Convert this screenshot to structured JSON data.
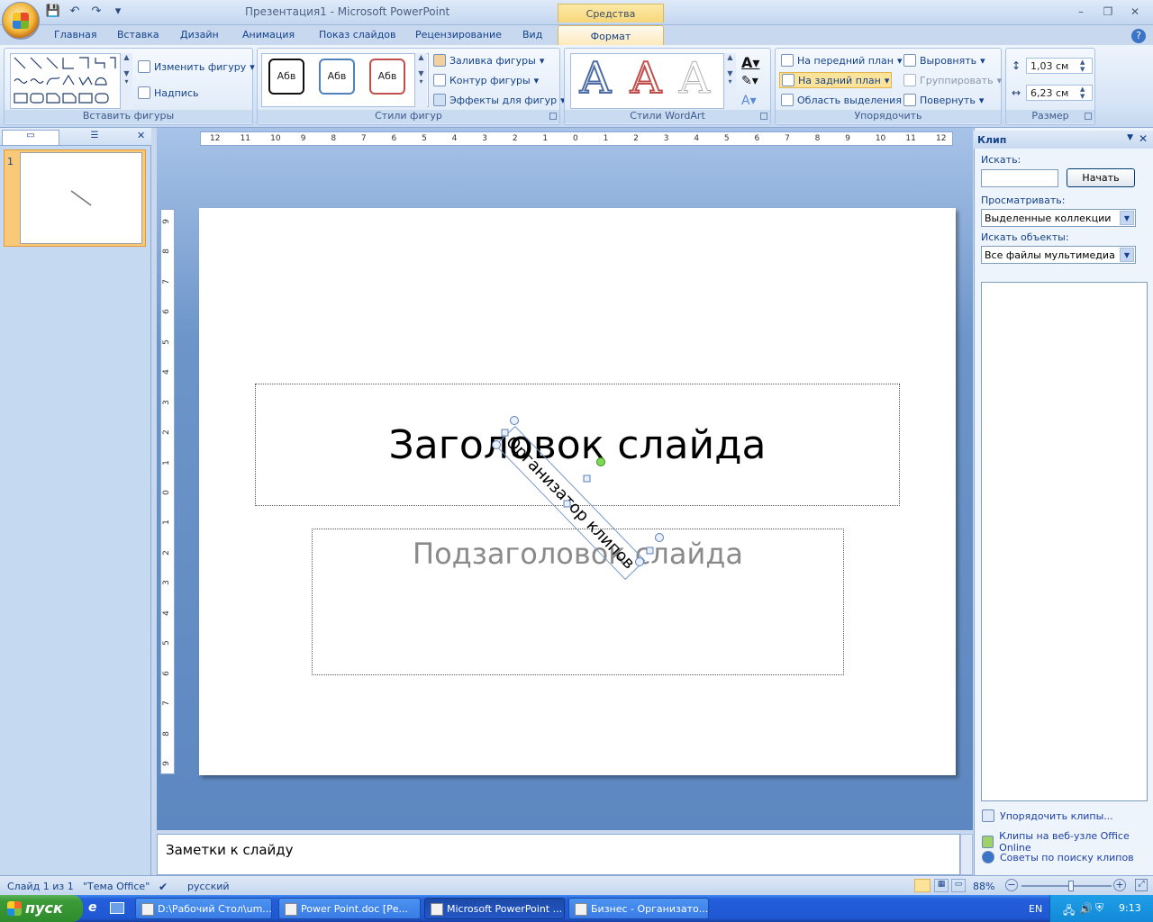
{
  "window": {
    "title": "Презентация1 - Microsoft PowerPoint",
    "context_tab_header": "Средства рисования"
  },
  "tabs": [
    {
      "label": "Главная"
    },
    {
      "label": "Вставка"
    },
    {
      "label": "Дизайн"
    },
    {
      "label": "Анимация"
    },
    {
      "label": "Показ слайдов"
    },
    {
      "label": "Рецензирование"
    },
    {
      "label": "Вид"
    },
    {
      "label": "Формат",
      "active": true
    }
  ],
  "ribbon": {
    "insert_shapes": {
      "label": "Вставить фигуры",
      "change_shape": "Изменить фигуру",
      "textbox": "Надпись"
    },
    "shape_styles": {
      "label": "Стили фигур",
      "preview_text": "Абв",
      "fill": "Заливка фигуры",
      "outline": "Контур фигуры",
      "effects": "Эффекты для фигур"
    },
    "wordart_styles": {
      "label": "Стили WordArt",
      "letter": "A"
    },
    "arrange": {
      "label": "Упорядочить",
      "bring_front": "На передний план",
      "send_back": "На задний план",
      "selection_pane": "Область выделения",
      "align": "Выровнять",
      "group": "Группировать",
      "rotate": "Повернуть"
    },
    "size": {
      "label": "Размер",
      "height": "1,03 см",
      "width": "6,23 см"
    }
  },
  "left_pane": {
    "slide_number": "1"
  },
  "ruler": {
    "h_ticks": [
      "12",
      "11",
      "10",
      "9",
      "8",
      "7",
      "6",
      "5",
      "4",
      "3",
      "2",
      "1",
      "0",
      "1",
      "2",
      "3",
      "4",
      "5",
      "6",
      "7",
      "8",
      "9",
      "10",
      "11",
      "12"
    ],
    "v_ticks": [
      "9",
      "8",
      "7",
      "6",
      "5",
      "4",
      "3",
      "2",
      "1",
      "0",
      "1",
      "2",
      "3",
      "4",
      "5",
      "6",
      "7",
      "8",
      "9"
    ]
  },
  "slide": {
    "title": "Заголовок слайда",
    "subtitle": "Подзаголовок слайда",
    "rotated_textbox": "Организатор клипов"
  },
  "clip_pane": {
    "title": "Клип",
    "search_label": "Искать:",
    "search_value": "",
    "search_button": "Начать",
    "browse_label": "Просматривать:",
    "browse_value": "Выделенные коллекции",
    "objects_label": "Искать объекты:",
    "objects_value": "Все файлы мультимедиа",
    "links": [
      "Упорядочить клипы...",
      "Клипы на веб-узле Office Online",
      "Советы по поиску клипов"
    ]
  },
  "notes": {
    "placeholder": "Заметки к слайду"
  },
  "status": {
    "slide_of": "Слайд 1 из 1",
    "theme": "\"Тема Office\"",
    "language": "русский",
    "zoom": "88%",
    "zoom_level": 0.55
  },
  "taskbar": {
    "start": "пуск",
    "items": [
      {
        "label": "D:\\Рабочий Стол\\um..."
      },
      {
        "label": "Power Point.doc [Ре..."
      },
      {
        "label": "Microsoft PowerPoint ...",
        "active": true
      },
      {
        "label": "Бизнес - Организато..."
      }
    ],
    "lang": "EN",
    "clock": "9:13"
  },
  "colors": {
    "accent": "#15428b",
    "context_tab": "#f8d77a",
    "selected_button": "#fbe39a",
    "link": "#1d3fa8"
  }
}
